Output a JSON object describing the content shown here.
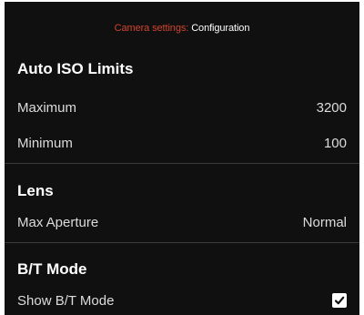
{
  "header": {
    "prefix": "Camera settings:",
    "title": "Configuration"
  },
  "sections": [
    {
      "title": "Auto ISO Limits",
      "rows": [
        {
          "label": "Maximum",
          "value": "3200"
        },
        {
          "label": "Minimum",
          "value": "100"
        }
      ]
    },
    {
      "title": "Lens",
      "rows": [
        {
          "label": "Max Aperture",
          "value": "Normal"
        }
      ]
    },
    {
      "title": "B/T Mode",
      "rows": [
        {
          "label": "Show B/T Mode",
          "checked": true
        }
      ]
    }
  ],
  "colors": {
    "background": "#101010",
    "accent": "#d2442d",
    "text": "#ffffff",
    "divider": "#3a3a3a"
  },
  "icons": {
    "checkbox": "checkmark-icon"
  }
}
